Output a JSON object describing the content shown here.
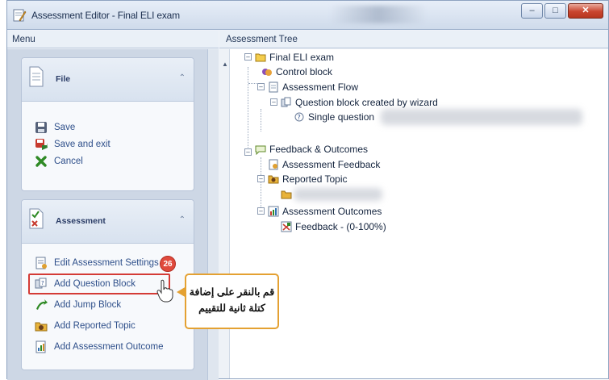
{
  "window": {
    "title": "Assessment Editor - Final ELI exam"
  },
  "menu": {
    "header": "Menu",
    "file": {
      "title": "File",
      "items": [
        {
          "label": "Save",
          "icon": "save-icon"
        },
        {
          "label": "Save and exit",
          "icon": "save-exit-icon"
        },
        {
          "label": "Cancel",
          "icon": "cancel-icon"
        }
      ]
    },
    "assessment": {
      "title": "Assessment",
      "items": [
        {
          "label": "Edit Assessment Settings",
          "icon": "settings-icon"
        },
        {
          "label": "Add Question Block",
          "icon": "question-block-icon"
        },
        {
          "label": "Add Jump Block",
          "icon": "jump-block-icon"
        },
        {
          "label": "Add Reported Topic",
          "icon": "reported-topic-icon"
        },
        {
          "label": "Add Assessment Outcome",
          "icon": "outcome-icon"
        }
      ]
    }
  },
  "annotation": {
    "step_badge": "26",
    "tooltip_line1": "قم بالنقر على إضافة",
    "tooltip_line2": "كتلة ثانية للتقييم"
  },
  "tree": {
    "header": "Assessment Tree",
    "nodes": [
      {
        "label": "Final ELI exam"
      },
      {
        "label": "Control block"
      },
      {
        "label": "Assessment Flow"
      },
      {
        "label": "Question block created by wizard"
      },
      {
        "label": "Single question"
      },
      {
        "label": "Feedback & Outcomes"
      },
      {
        "label": "Assessment Feedback"
      },
      {
        "label": "Reported Topic"
      },
      {
        "label": ""
      },
      {
        "label": "Assessment Outcomes"
      },
      {
        "label": "Feedback - (0-100%)"
      }
    ]
  },
  "colors": {
    "highlight": "#d43b36",
    "badge": "#e04a3d",
    "tooltip_border": "#e4a132",
    "link": "#2e4f8a"
  }
}
